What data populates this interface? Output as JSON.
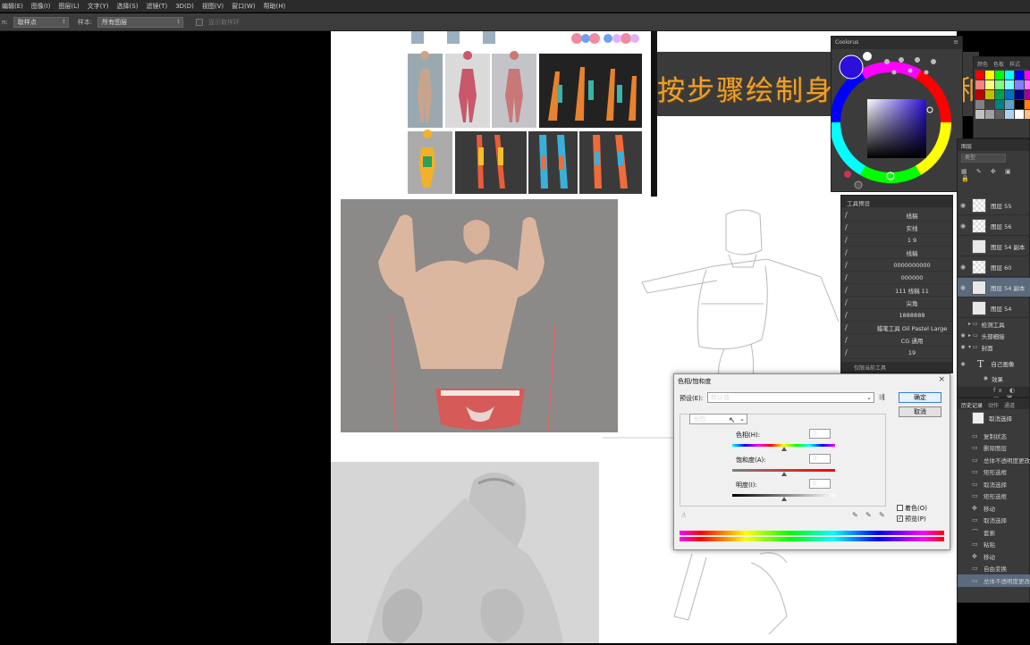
{
  "menubar": {
    "items": [
      "编辑(E)",
      "图像(I)",
      "图层(L)",
      "文字(Y)",
      "选择(S)",
      "滤镜(T)",
      "3D(D)",
      "视图(V)",
      "窗口(W)",
      "帮助(H)"
    ]
  },
  "options": {
    "prefix": "n:",
    "sample_size": "取样点",
    "sample_label": "样本:",
    "sample_value": "所有图层",
    "show_ring": "显示取样环"
  },
  "banner": {
    "text": "按步骤绘制身",
    "right_text": "和"
  },
  "coolorus": {
    "title": "Coolorus",
    "foreground": "#2a10d8",
    "background": "#ffffff"
  },
  "swatches": {
    "tabs": [
      "颜色",
      "色板",
      "样式"
    ],
    "colors": [
      "#ff0000",
      "#ffff00",
      "#00ff00",
      "#00ffff",
      "#0000ff",
      "#ff00ff",
      "#ff8080",
      "#ffff80",
      "#80ff80",
      "#80ffff",
      "#8080ff",
      "#ff80ff",
      "#c00000",
      "#c0c000",
      "#00a050",
      "#0070c0",
      "#000080",
      "#a000a0",
      "#808080",
      "#404040",
      "#008080",
      "#60a0c0",
      "#000000",
      "#ff8000",
      "#c0c0c0",
      "#a0a0a0",
      "#606060",
      "#b0d0f0",
      "#ffffff",
      "#ffc080"
    ]
  },
  "layers": {
    "title": "图层",
    "kind_label": "类型",
    "rows": [
      {
        "name": "图层 55",
        "thumb": "checker",
        "selected": false
      },
      {
        "name": "图层 56",
        "thumb": "checker",
        "selected": false
      },
      {
        "name": "图层 54 副本",
        "thumb": "figure",
        "selected": false
      },
      {
        "name": "图层 60",
        "thumb": "checker",
        "selected": false
      },
      {
        "name": "图层 54 副本",
        "thumb": "figure",
        "selected": true
      },
      {
        "name": "图层 54",
        "thumb": "figure",
        "selected": false
      }
    ],
    "groups": [
      "检测工具",
      "头部细接",
      "封面"
    ],
    "text_layer": "自己画像",
    "effect": "效果"
  },
  "tool_presets": {
    "title": "工具预设",
    "items": [
      "线稿",
      "实线",
      "1  9",
      "线稿",
      "0000000000",
      "000000",
      "111 线稿 11",
      "尖角",
      "1888888",
      "蜡笔工具 Oil Pastel Large",
      "CG 通用",
      "19"
    ],
    "footer": "仅限当前工具"
  },
  "history": {
    "tabs": [
      "历史记录",
      "动作",
      "通道"
    ],
    "snapshot": "取消选择",
    "items": [
      "复制状态",
      "删除图层",
      "总体不透明度更改",
      "矩形选框",
      "取消选择",
      "矩形选框",
      "移动",
      "取消选择",
      "套索",
      "粘贴",
      "移动",
      "自由变换",
      "总体不透明度更改"
    ]
  },
  "dialog": {
    "title": "色相/饱和度",
    "preset_label": "预设(E):",
    "preset_value": "默认值",
    "ok": "确定",
    "cancel": "取消",
    "channel": "全图",
    "hue_label": "色相(H):",
    "hue_value": "0",
    "sat_label": "饱和度(A):",
    "sat_value": "0",
    "light_label": "明度(I):",
    "light_value": "0",
    "colorize_label": "着色(O)",
    "colorize_checked": false,
    "preview_label": "预览(P)",
    "preview_checked": true
  }
}
